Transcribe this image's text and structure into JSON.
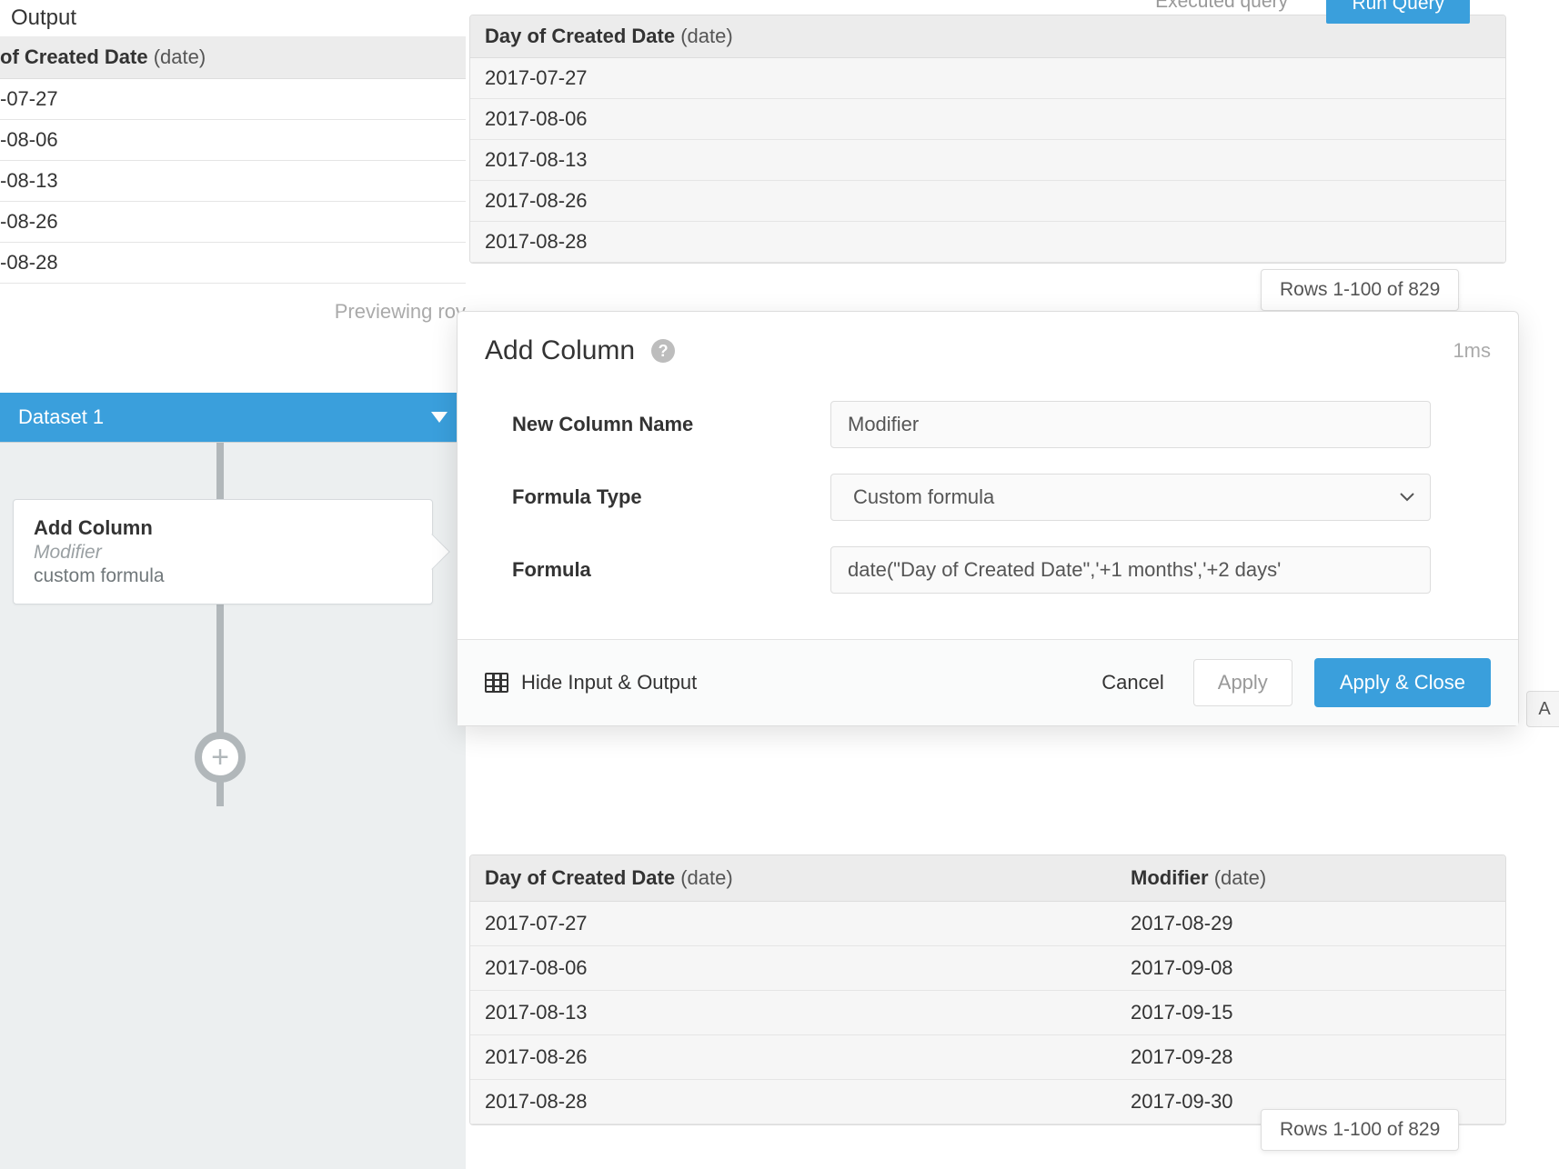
{
  "bg_left": {
    "header_frag": "Output",
    "col_label": "of Created Date",
    "col_type": "(date)",
    "rows": [
      "-07-27",
      "-08-06",
      "-08-13",
      "-08-26",
      "-08-28"
    ],
    "preview_text": "Previewing rov"
  },
  "right_top": {
    "executed_label": "Executed query",
    "run_label": "Run Query",
    "col_label": "Day of Created Date",
    "col_type": "(date)",
    "rows": [
      "2017-07-27",
      "2017-08-06",
      "2017-08-13",
      "2017-08-26",
      "2017-08-28"
    ],
    "rows_badge": "Rows 1-100 of 829"
  },
  "pipeline": {
    "dataset_label": "Dataset 1",
    "card": {
      "title": "Add Column",
      "subtitle": "Modifier",
      "desc": "custom formula"
    }
  },
  "modal": {
    "title": "Add Column",
    "timer": "1ms",
    "labels": {
      "name": "New Column Name",
      "type": "Formula Type",
      "formula": "Formula"
    },
    "values": {
      "name": "Modifier",
      "type": "Custom formula",
      "formula": "date(\"Day of Created Date\",'+1 months','+2 days'"
    },
    "footer": {
      "hide": "Hide Input & Output",
      "cancel": "Cancel",
      "apply": "Apply",
      "apply_close": "Apply & Close"
    }
  },
  "output": {
    "col_a_label": "Day of Created Date",
    "col_a_type": "(date)",
    "col_b_label": "Modifier",
    "col_b_type": "(date)",
    "rows": [
      {
        "a": "2017-07-27",
        "b": "2017-08-29"
      },
      {
        "a": "2017-08-06",
        "b": "2017-09-08"
      },
      {
        "a": "2017-08-13",
        "b": "2017-09-15"
      },
      {
        "a": "2017-08-26",
        "b": "2017-09-28"
      },
      {
        "a": "2017-08-28",
        "b": "2017-09-30"
      }
    ],
    "rows_badge": "Rows 1-100 of 829"
  },
  "side_tab": "A"
}
